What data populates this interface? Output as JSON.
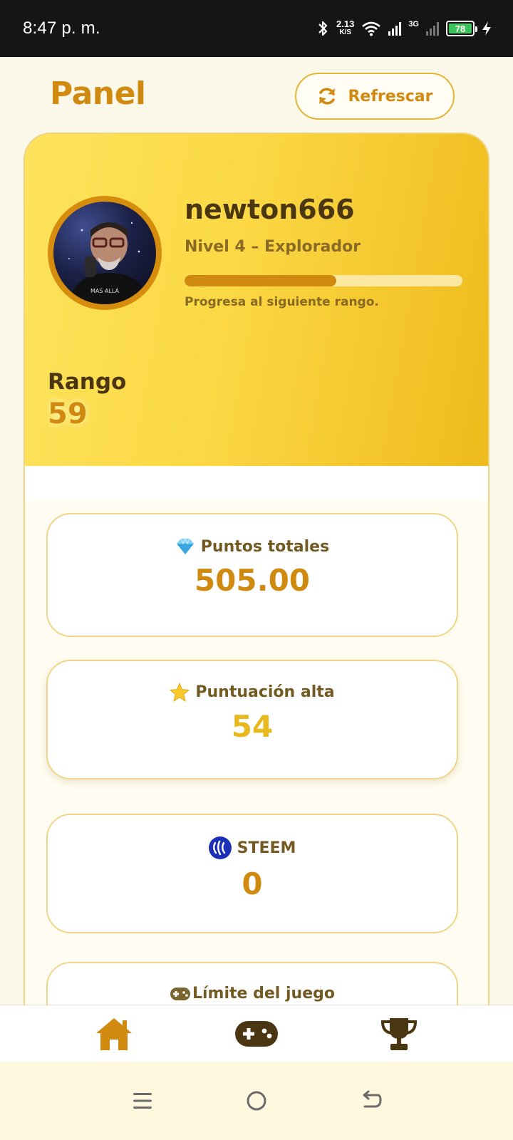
{
  "status_bar": {
    "time": "8:47 p. m.",
    "net_speed_value": "2.13",
    "net_speed_unit": "K/S",
    "network_type": "3G",
    "battery": "78"
  },
  "header": {
    "title": "Panel",
    "refresh_label": "Refrescar"
  },
  "profile": {
    "username": "newton666",
    "level": "Nivel 4 – Explorador",
    "progress_fraction": 0.545,
    "progress_note": "Progresa al siguiente rango.",
    "rank_label": "Rango",
    "rank_value": "59"
  },
  "stats": [
    {
      "icon": "diamond-icon",
      "title": "Puntos totales",
      "value": "505.00"
    },
    {
      "icon": "star-icon",
      "title": "Puntuación alta",
      "value": "54"
    },
    {
      "icon": "steem-icon",
      "title": "STEEM",
      "value": "0"
    },
    {
      "icon": "gamepad-icon",
      "title": "Límite del juego",
      "value": ""
    }
  ],
  "bottom_nav": [
    "home-icon",
    "gamepad-icon",
    "trophy-icon"
  ],
  "colors": {
    "accent": "#d08a0f",
    "accent_light": "#fbd844",
    "card_border": "#f0d68a",
    "text_dark": "#4a3610",
    "steem_blue": "#1c2fb7",
    "star_yellow": "#e9b81e"
  }
}
